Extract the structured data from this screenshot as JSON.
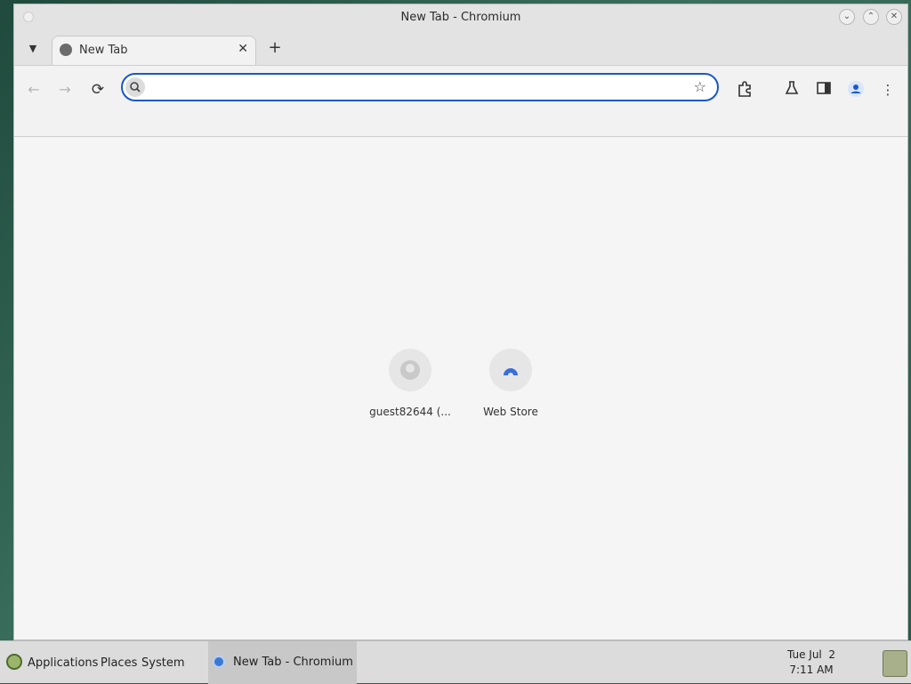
{
  "window": {
    "title": "New Tab - Chromium"
  },
  "tabs": [
    {
      "title": "New Tab",
      "close_label": "✕"
    }
  ],
  "toolbar": {
    "back_icon": "arrow-left-icon",
    "forward_icon": "arrow-right-icon",
    "reload_icon": "reload-icon",
    "omnibox_value": "",
    "omnibox_placeholder": "",
    "bookmark_icon": "star-icon",
    "extensions_icon": "puzzle-icon",
    "labs_icon": "flask-icon",
    "sidepanel_icon": "sidepanel-icon",
    "profile_icon": "person-icon",
    "menu_icon": "more-vert-icon"
  },
  "shortcuts": [
    {
      "label": "guest82644 (...",
      "icon": "github-icon"
    },
    {
      "label": "Web Store",
      "icon": "webstore-icon"
    }
  ],
  "taskbar": {
    "menu": [
      "Applications",
      "Places",
      "System"
    ],
    "task": "New Tab - Chromium",
    "clock": {
      "date": "Tue Jul  2",
      "time": "7:11 AM"
    }
  },
  "colors": {
    "accent": "#1a57c9",
    "titlebar": "#e3e3e3",
    "taskbar": "#dcdcdc"
  }
}
